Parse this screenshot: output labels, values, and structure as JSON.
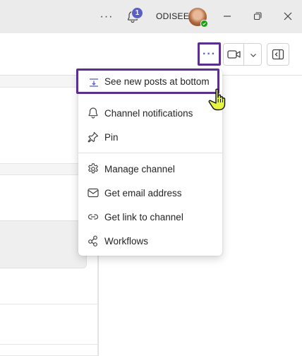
{
  "titlebar": {
    "notification_count": "1",
    "org_name": "ODISEE"
  },
  "menu": {
    "items": [
      {
        "label": "See new posts at bottom",
        "icon": "posts-at-bottom-icon"
      },
      {
        "label": "Channel notifications",
        "icon": "bell-icon"
      },
      {
        "label": "Pin",
        "icon": "pin-icon"
      },
      {
        "label": "Manage channel",
        "icon": "gear-icon"
      },
      {
        "label": "Get email address",
        "icon": "email-icon"
      },
      {
        "label": "Get link to channel",
        "icon": "link-icon"
      },
      {
        "label": "Workflows",
        "icon": "workflows-icon"
      }
    ]
  },
  "colors": {
    "accent": "#5b5fc7",
    "highlight_border": "#5b2e91",
    "presence_available": "#13a10e",
    "cursor_fill": "#e6f542"
  }
}
